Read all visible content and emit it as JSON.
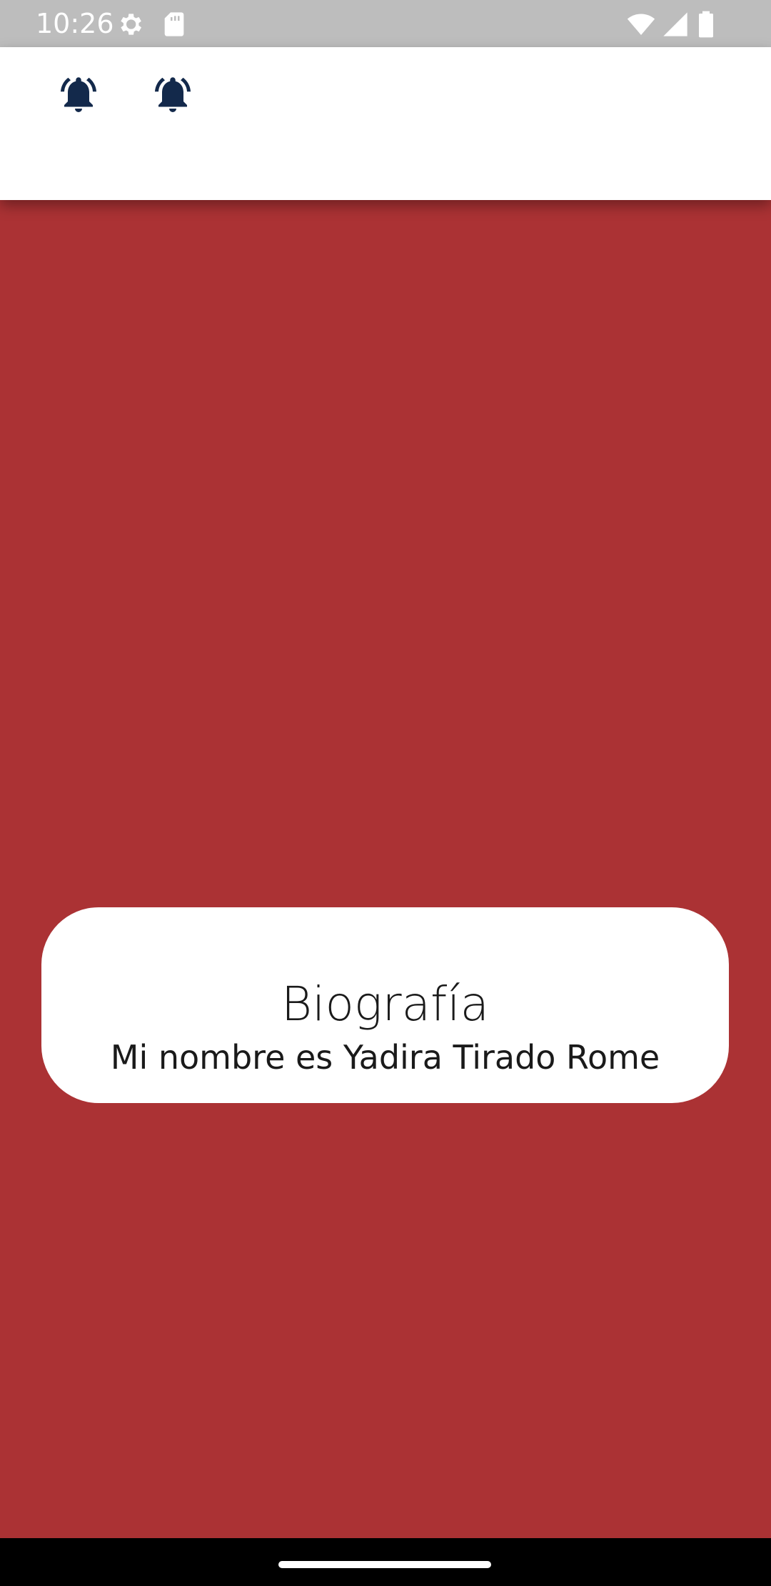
{
  "status_bar": {
    "time": "10:26",
    "icons": [
      "settings-icon",
      "sd-card-icon",
      "wifi-icon",
      "cellular-signal-icon",
      "battery-icon"
    ]
  },
  "app_bar": {
    "icons": [
      "notification-bell-icon",
      "notification-bell-icon"
    ],
    "icon_color": "#13294b"
  },
  "content": {
    "background_color": "#ab3234",
    "card": {
      "title": "Biografía",
      "text": "Mi nombre es Yadira Tirado Rome"
    }
  }
}
